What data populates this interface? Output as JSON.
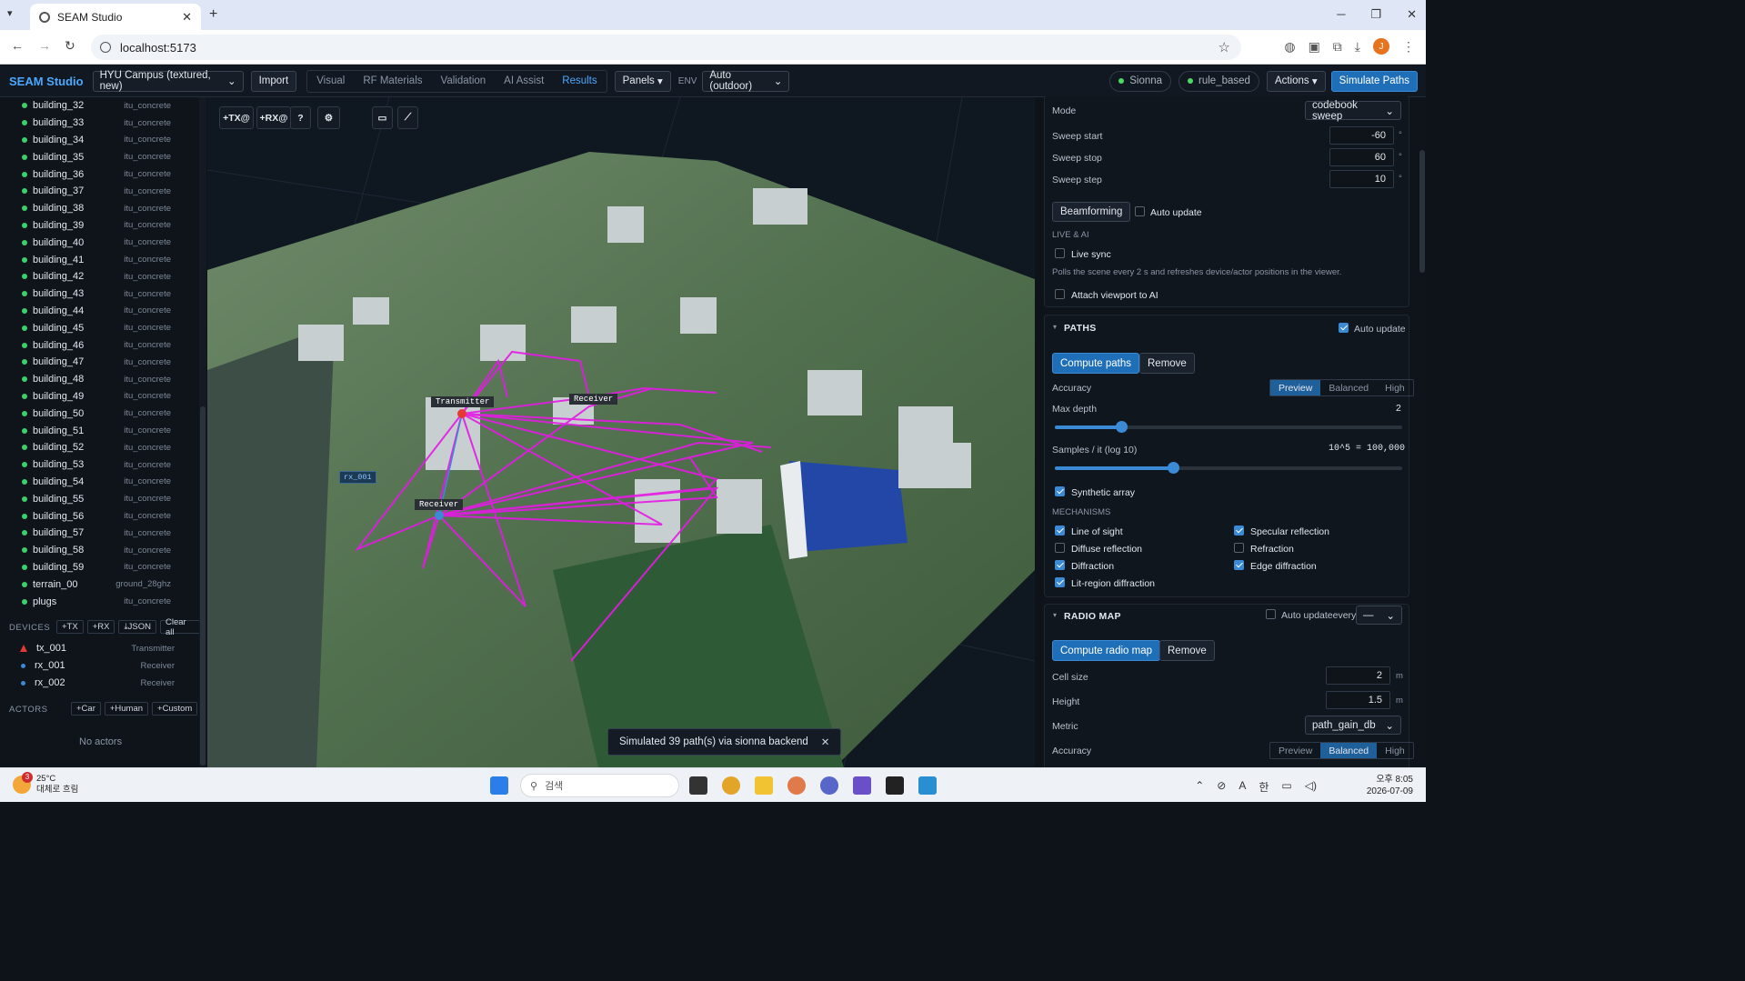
{
  "browser": {
    "tab_title": "SEAM Studio",
    "url": "localhost:5173",
    "avatar": "J"
  },
  "app": {
    "brand": "SEAM Studio",
    "scene_select": "HYU Campus (textured, new)",
    "import": "Import",
    "nav_tabs": [
      "Visual",
      "RF Materials",
      "Validation",
      "AI Assist",
      "Results"
    ],
    "panels": "Panels",
    "env_label": "ENV",
    "env_select": "Auto (outdoor)",
    "engine": "Sionna",
    "policy": "rule_based",
    "actions": "Actions",
    "simulate": "Simulate Paths"
  },
  "objects": [
    {
      "name": "building_32",
      "mat": "itu_concrete"
    },
    {
      "name": "building_33",
      "mat": "itu_concrete"
    },
    {
      "name": "building_34",
      "mat": "itu_concrete"
    },
    {
      "name": "building_35",
      "mat": "itu_concrete"
    },
    {
      "name": "building_36",
      "mat": "itu_concrete"
    },
    {
      "name": "building_37",
      "mat": "itu_concrete"
    },
    {
      "name": "building_38",
      "mat": "itu_concrete"
    },
    {
      "name": "building_39",
      "mat": "itu_concrete"
    },
    {
      "name": "building_40",
      "mat": "itu_concrete"
    },
    {
      "name": "building_41",
      "mat": "itu_concrete"
    },
    {
      "name": "building_42",
      "mat": "itu_concrete"
    },
    {
      "name": "building_43",
      "mat": "itu_concrete"
    },
    {
      "name": "building_44",
      "mat": "itu_concrete"
    },
    {
      "name": "building_45",
      "mat": "itu_concrete"
    },
    {
      "name": "building_46",
      "mat": "itu_concrete"
    },
    {
      "name": "building_47",
      "mat": "itu_concrete"
    },
    {
      "name": "building_48",
      "mat": "itu_concrete"
    },
    {
      "name": "building_49",
      "mat": "itu_concrete"
    },
    {
      "name": "building_50",
      "mat": "itu_concrete"
    },
    {
      "name": "building_51",
      "mat": "itu_concrete"
    },
    {
      "name": "building_52",
      "mat": "itu_concrete"
    },
    {
      "name": "building_53",
      "mat": "itu_concrete"
    },
    {
      "name": "building_54",
      "mat": "itu_concrete"
    },
    {
      "name": "building_55",
      "mat": "itu_concrete"
    },
    {
      "name": "building_56",
      "mat": "itu_concrete"
    },
    {
      "name": "building_57",
      "mat": "itu_concrete"
    },
    {
      "name": "building_58",
      "mat": "itu_concrete"
    },
    {
      "name": "building_59",
      "mat": "itu_concrete"
    },
    {
      "name": "terrain_00",
      "mat": "ground_28ghz"
    },
    {
      "name": "plugs",
      "mat": "itu_concrete"
    }
  ],
  "devices": {
    "title": "DEVICES",
    "add_tx": "+TX",
    "add_rx": "+RX",
    "json": "⤓JSON",
    "clear": "Clear all",
    "items": [
      {
        "name": "tx_001",
        "type": "Transmitter",
        "color": "#e53935"
      },
      {
        "name": "rx_001",
        "type": "Receiver",
        "color": "#3b8ad6"
      },
      {
        "name": "rx_002",
        "type": "Receiver",
        "color": "#3b8ad6"
      }
    ]
  },
  "actors": {
    "title": "ACTORS",
    "car": "+Car",
    "human": "+Human",
    "custom": "+Custom",
    "empty": "No actors"
  },
  "viewport": {
    "tool_tx": "+TX@",
    "tool_rx": "+RX@",
    "tool_help": "?",
    "label_tx": "Transmitter",
    "label_rx1": "Receiver",
    "label_rx2": "Receiver",
    "label_rx001": "rx_001",
    "toast": "Simulated 39 path(s) via sionna backend",
    "path_color": "#e619e6"
  },
  "beam": {
    "mode_label": "Mode",
    "mode_value": "codebook sweep",
    "sweep_start_label": "Sweep start",
    "sweep_start": "-60",
    "sweep_stop_label": "Sweep stop",
    "sweep_stop": "60",
    "sweep_step_label": "Sweep step",
    "sweep_step": "10",
    "unit": "°",
    "beamforming": "Beamforming",
    "auto_update": "Auto update",
    "live_title": "LIVE & AI",
    "live_sync": "Live sync",
    "live_help": "Polls the scene every 2 s and refreshes device/actor positions in the viewer.",
    "attach": "Attach viewport to AI"
  },
  "paths": {
    "title": "PATHS",
    "auto_update": "Auto update",
    "compute": "Compute paths",
    "remove": "Remove",
    "accuracy_label": "Accuracy",
    "accuracy_options": [
      "Preview",
      "Balanced",
      "High"
    ],
    "accuracy_selected": "Preview",
    "max_depth_label": "Max depth",
    "max_depth": "2",
    "samples_label": "Samples / it (log 10)",
    "samples_value": "10^5 = 100,000",
    "synthetic": "Synthetic array",
    "mech_title": "MECHANISMS",
    "mechanisms": [
      {
        "label": "Line of sight",
        "on": true
      },
      {
        "label": "Specular reflection",
        "on": true
      },
      {
        "label": "Diffuse reflection",
        "on": false
      },
      {
        "label": "Refraction",
        "on": false
      },
      {
        "label": "Diffraction",
        "on": true
      },
      {
        "label": "Edge diffraction",
        "on": true
      },
      {
        "label": "Lit-region diffraction",
        "on": true
      }
    ]
  },
  "radio": {
    "title": "RADIO MAP",
    "auto_update": "Auto updateevery",
    "every_value": "—",
    "compute": "Compute radio map",
    "remove": "Remove",
    "cell_label": "Cell size",
    "cell": "2",
    "height_label": "Height",
    "height": "1.5",
    "unit": "m",
    "metric_label": "Metric",
    "metric": "path_gain_db",
    "accuracy_label": "Accuracy",
    "accuracy_options": [
      "Preview",
      "Balanced",
      "High"
    ],
    "accuracy_selected": "Balanced"
  },
  "taskbar": {
    "temp": "25°C",
    "weather": "대체로 흐림",
    "badge": "3",
    "search": "검색",
    "time": "오후 8:05",
    "date": "2026-07-09"
  }
}
